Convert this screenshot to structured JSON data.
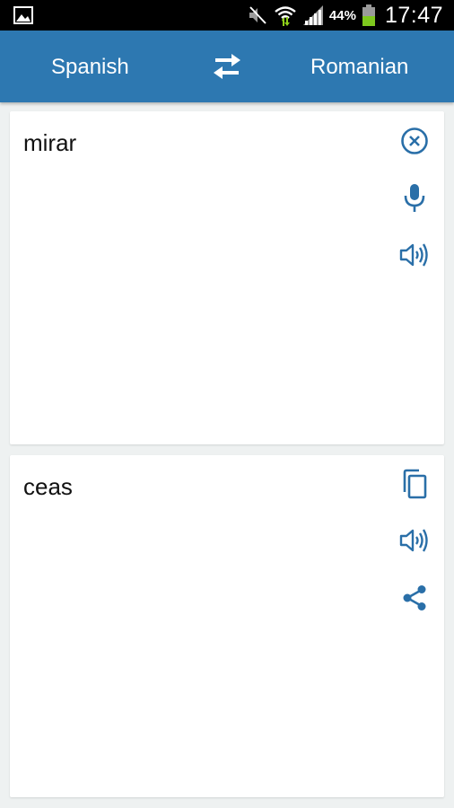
{
  "status_bar": {
    "battery_percent": "44%",
    "time": "17:47",
    "icons": [
      "gallery-icon",
      "mute-icon",
      "wifi-icon",
      "signal-icon",
      "battery-icon"
    ]
  },
  "app_bar": {
    "source_language": "Spanish",
    "target_language": "Romanian",
    "swap_icon": "swap-arrows-icon"
  },
  "input_card": {
    "text": "mirar",
    "icons": [
      "clear-icon",
      "microphone-icon",
      "speaker-icon"
    ]
  },
  "output_card": {
    "text": "ceas",
    "icons": [
      "copy-icon",
      "speaker-icon",
      "share-icon"
    ]
  },
  "colors": {
    "app_bar": "#2d78b1",
    "icon_accent": "#2a6fa8",
    "background": "#eef1f1",
    "status_bar": "#000000"
  }
}
